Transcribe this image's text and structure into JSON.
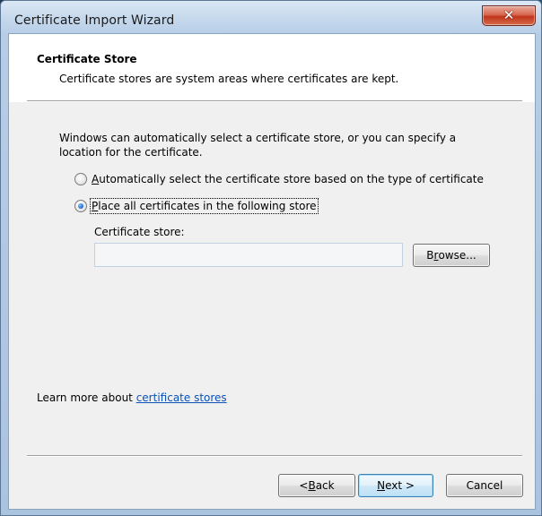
{
  "window": {
    "title": "Certificate Import Wizard",
    "close_symbol": "✕"
  },
  "header": {
    "title": "Certificate Store",
    "subtitle": "Certificate stores are system areas where certificates are kept."
  },
  "body": {
    "description": "Windows can automatically select a certificate store, or you can specify a location for the certificate.",
    "options": [
      {
        "label_mnemonic": "A",
        "label_rest": "utomatically select the certificate store based on the type of certificate",
        "selected": false
      },
      {
        "label_mnemonic": "P",
        "label_rest": "lace all certificates in the following store",
        "selected": true
      }
    ],
    "store_label": "Certificate store:",
    "store_value": "",
    "browse_pre": "B",
    "browse_mnemonic": "r",
    "browse_post": "owse..."
  },
  "learn_more": {
    "prefix": "Learn more about ",
    "link": "certificate stores"
  },
  "footer": {
    "back_pre": "< ",
    "back_mnemonic": "B",
    "back_post": "ack",
    "next_mnemonic": "N",
    "next_post": "ext >",
    "cancel_label": "Cancel"
  },
  "colors": {
    "accent_link": "#0a52b8",
    "close_red": "#c1361c",
    "default_button_border": "#3c7fb1"
  }
}
